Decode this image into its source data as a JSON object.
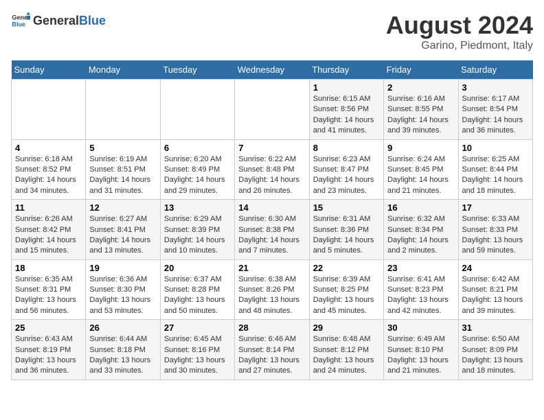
{
  "header": {
    "logo_general": "General",
    "logo_blue": "Blue",
    "main_title": "August 2024",
    "sub_title": "Garino, Piedmont, Italy"
  },
  "days_of_week": [
    "Sunday",
    "Monday",
    "Tuesday",
    "Wednesday",
    "Thursday",
    "Friday",
    "Saturday"
  ],
  "weeks": [
    [
      {
        "day": "",
        "info": ""
      },
      {
        "day": "",
        "info": ""
      },
      {
        "day": "",
        "info": ""
      },
      {
        "day": "",
        "info": ""
      },
      {
        "day": "1",
        "info": "Sunrise: 6:15 AM\nSunset: 8:56 PM\nDaylight: 14 hours and 41 minutes."
      },
      {
        "day": "2",
        "info": "Sunrise: 6:16 AM\nSunset: 8:55 PM\nDaylight: 14 hours and 39 minutes."
      },
      {
        "day": "3",
        "info": "Sunrise: 6:17 AM\nSunset: 8:54 PM\nDaylight: 14 hours and 36 minutes."
      }
    ],
    [
      {
        "day": "4",
        "info": "Sunrise: 6:18 AM\nSunset: 8:52 PM\nDaylight: 14 hours and 34 minutes."
      },
      {
        "day": "5",
        "info": "Sunrise: 6:19 AM\nSunset: 8:51 PM\nDaylight: 14 hours and 31 minutes."
      },
      {
        "day": "6",
        "info": "Sunrise: 6:20 AM\nSunset: 8:49 PM\nDaylight: 14 hours and 29 minutes."
      },
      {
        "day": "7",
        "info": "Sunrise: 6:22 AM\nSunset: 8:48 PM\nDaylight: 14 hours and 26 minutes."
      },
      {
        "day": "8",
        "info": "Sunrise: 6:23 AM\nSunset: 8:47 PM\nDaylight: 14 hours and 23 minutes."
      },
      {
        "day": "9",
        "info": "Sunrise: 6:24 AM\nSunset: 8:45 PM\nDaylight: 14 hours and 21 minutes."
      },
      {
        "day": "10",
        "info": "Sunrise: 6:25 AM\nSunset: 8:44 PM\nDaylight: 14 hours and 18 minutes."
      }
    ],
    [
      {
        "day": "11",
        "info": "Sunrise: 6:26 AM\nSunset: 8:42 PM\nDaylight: 14 hours and 15 minutes."
      },
      {
        "day": "12",
        "info": "Sunrise: 6:27 AM\nSunset: 8:41 PM\nDaylight: 14 hours and 13 minutes."
      },
      {
        "day": "13",
        "info": "Sunrise: 6:29 AM\nSunset: 8:39 PM\nDaylight: 14 hours and 10 minutes."
      },
      {
        "day": "14",
        "info": "Sunrise: 6:30 AM\nSunset: 8:38 PM\nDaylight: 14 hours and 7 minutes."
      },
      {
        "day": "15",
        "info": "Sunrise: 6:31 AM\nSunset: 8:36 PM\nDaylight: 14 hours and 5 minutes."
      },
      {
        "day": "16",
        "info": "Sunrise: 6:32 AM\nSunset: 8:34 PM\nDaylight: 14 hours and 2 minutes."
      },
      {
        "day": "17",
        "info": "Sunrise: 6:33 AM\nSunset: 8:33 PM\nDaylight: 13 hours and 59 minutes."
      }
    ],
    [
      {
        "day": "18",
        "info": "Sunrise: 6:35 AM\nSunset: 8:31 PM\nDaylight: 13 hours and 56 minutes."
      },
      {
        "day": "19",
        "info": "Sunrise: 6:36 AM\nSunset: 8:30 PM\nDaylight: 13 hours and 53 minutes."
      },
      {
        "day": "20",
        "info": "Sunrise: 6:37 AM\nSunset: 8:28 PM\nDaylight: 13 hours and 50 minutes."
      },
      {
        "day": "21",
        "info": "Sunrise: 6:38 AM\nSunset: 8:26 PM\nDaylight: 13 hours and 48 minutes."
      },
      {
        "day": "22",
        "info": "Sunrise: 6:39 AM\nSunset: 8:25 PM\nDaylight: 13 hours and 45 minutes."
      },
      {
        "day": "23",
        "info": "Sunrise: 6:41 AM\nSunset: 8:23 PM\nDaylight: 13 hours and 42 minutes."
      },
      {
        "day": "24",
        "info": "Sunrise: 6:42 AM\nSunset: 8:21 PM\nDaylight: 13 hours and 39 minutes."
      }
    ],
    [
      {
        "day": "25",
        "info": "Sunrise: 6:43 AM\nSunset: 8:19 PM\nDaylight: 13 hours and 36 minutes."
      },
      {
        "day": "26",
        "info": "Sunrise: 6:44 AM\nSunset: 8:18 PM\nDaylight: 13 hours and 33 minutes."
      },
      {
        "day": "27",
        "info": "Sunrise: 6:45 AM\nSunset: 8:16 PM\nDaylight: 13 hours and 30 minutes."
      },
      {
        "day": "28",
        "info": "Sunrise: 6:46 AM\nSunset: 8:14 PM\nDaylight: 13 hours and 27 minutes."
      },
      {
        "day": "29",
        "info": "Sunrise: 6:48 AM\nSunset: 8:12 PM\nDaylight: 13 hours and 24 minutes."
      },
      {
        "day": "30",
        "info": "Sunrise: 6:49 AM\nSunset: 8:10 PM\nDaylight: 13 hours and 21 minutes."
      },
      {
        "day": "31",
        "info": "Sunrise: 6:50 AM\nSunset: 8:09 PM\nDaylight: 13 hours and 18 minutes."
      }
    ]
  ]
}
